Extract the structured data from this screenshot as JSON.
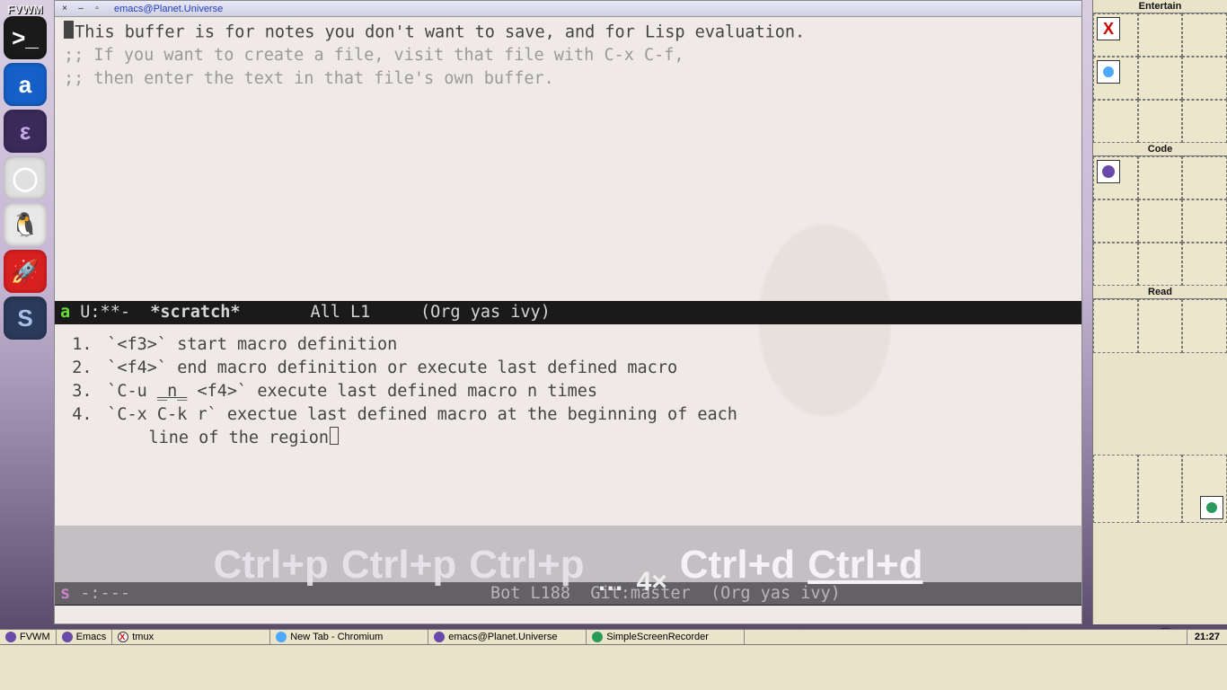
{
  "wm_label": "FVWM",
  "dock": [
    {
      "name": "terminal",
      "glyph": ">_"
    },
    {
      "name": "app-a",
      "glyph": "a"
    },
    {
      "name": "emacs",
      "glyph": "ε"
    },
    {
      "name": "chromium",
      "glyph": "◯"
    },
    {
      "name": "pidgin",
      "glyph": "🐧"
    },
    {
      "name": "launcher",
      "glyph": "🚀"
    },
    {
      "name": "app-s",
      "glyph": "S"
    }
  ],
  "window": {
    "title": "emacs@Planet.Universe"
  },
  "scratch": {
    "line1": "This buffer is for notes you don't want to save, and for Lisp evaluation.",
    "line2": ";; If you want to create a file, visit that file with C-x C-f,",
    "line3": ";; then enter the text in that file's own buffer."
  },
  "modeline_top": {
    "evil": "a",
    "flags": " U:**- ",
    "buffer": " *scratch*",
    "pad1": "       ",
    "pos": "All L1",
    "pad2": "     ",
    "modes": "(Org yas ivy)"
  },
  "notes": {
    "i1": "`<f3>` start macro definition",
    "i2": "`<f4>` end macro definition or execute last defined macro",
    "i3a": "`C-u ",
    "i3u": "_n_",
    "i3b": " <f4>` execute last defined macro n times",
    "i4a": "`C-x C-k r` exectue last defined macro at the beginning of each",
    "i4b": "line of the region"
  },
  "modeline_bot": {
    "evil": "s",
    "flags": " -:---",
    "pad1": "                                    ",
    "pos": "Bot L188",
    "git": "  Git:master",
    "pad2": "  ",
    "modes": "(Org yas ivy)"
  },
  "keycast": {
    "k1": "Ctrl+p",
    "k2": "Ctrl+p",
    "k3": "Ctrl+p",
    "dots": "…",
    "count": "4×",
    "k4": "Ctrl+d",
    "k5": "Ctrl+d"
  },
  "right": {
    "sec1": "Entertain",
    "sec2": "Code",
    "sec3": "Read"
  },
  "taskbar": {
    "t1": "FVWM",
    "t2": "Emacs",
    "t3": "tmux",
    "t4": "New Tab - Chromium",
    "t5": "emacs@Planet.Universe",
    "t6": "SimpleScreenRecorder",
    "clock": "21:27"
  }
}
